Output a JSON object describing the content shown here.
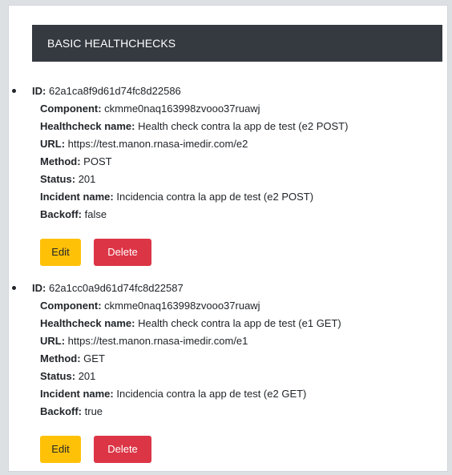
{
  "panel": {
    "title": "BASIC HEALTHCHECKS"
  },
  "labels": {
    "id": "ID:",
    "component": "Component:",
    "name": "Healthcheck name:",
    "url": "URL:",
    "method": "Method:",
    "status": "Status:",
    "incident": "Incident name:",
    "backoff": "Backoff:"
  },
  "healthchecks": [
    {
      "id": "62a1ca8f9d61d74fc8d22586",
      "component": "ckmme0naq163998zvooo37ruawj",
      "name": "Health check contra la app de test (e2 POST)",
      "url": "https://test.manon.rnasa-imedir.com/e2",
      "method": "POST",
      "status": "201",
      "incident": "Incidencia contra la app de test (e2 POST)",
      "backoff": "false",
      "edit_label": "Edit",
      "delete_label": "Delete"
    },
    {
      "id": "62a1cc0a9d61d74fc8d22587",
      "component": "ckmme0naq163998zvooo37ruawj",
      "name": "Health check contra la app de test (e1 GET)",
      "url": "https://test.manon.rnasa-imedir.com/e1",
      "method": "GET",
      "status": "201",
      "incident": "Incidencia contra la app de test (e2 GET)",
      "backoff": "true",
      "edit_label": "Edit",
      "delete_label": "Delete"
    }
  ]
}
